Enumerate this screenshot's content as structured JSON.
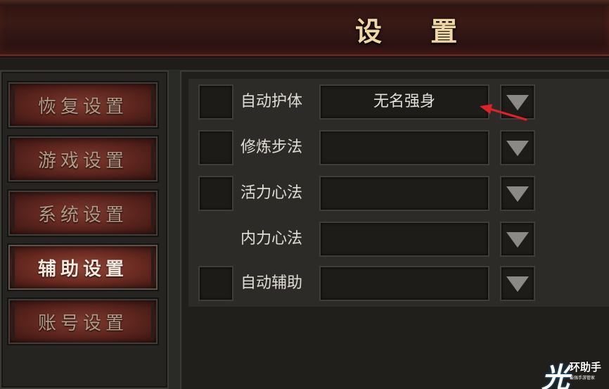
{
  "title": "设  置",
  "sidebar": {
    "items": [
      {
        "label": "恢复设置"
      },
      {
        "label": "游戏设置"
      },
      {
        "label": "系统设置"
      },
      {
        "label": "辅助设置"
      },
      {
        "label": "账号设置"
      }
    ],
    "active": "辅助设置"
  },
  "settings": {
    "rows": [
      {
        "label": "自动护体",
        "value": "无名强身",
        "has_checkbox": true
      },
      {
        "label": "修炼步法",
        "value": "",
        "has_checkbox": true
      },
      {
        "label": "活力心法",
        "value": "",
        "has_checkbox": true
      },
      {
        "label": "内力心法",
        "value": "",
        "has_checkbox": false
      },
      {
        "label": "自动辅助",
        "value": "",
        "has_checkbox": true
      }
    ]
  },
  "icons": {
    "dropdown": "triangle-down-icon",
    "annotation": "red-arrow-icon"
  },
  "colors": {
    "title_text": "#f0d7a6",
    "menu_active_bg": "#8e4636",
    "annotation_arrow": "#e0202a"
  },
  "watermark": {
    "logo": "光",
    "name": "环助手",
    "sub": "最强手游管家"
  }
}
